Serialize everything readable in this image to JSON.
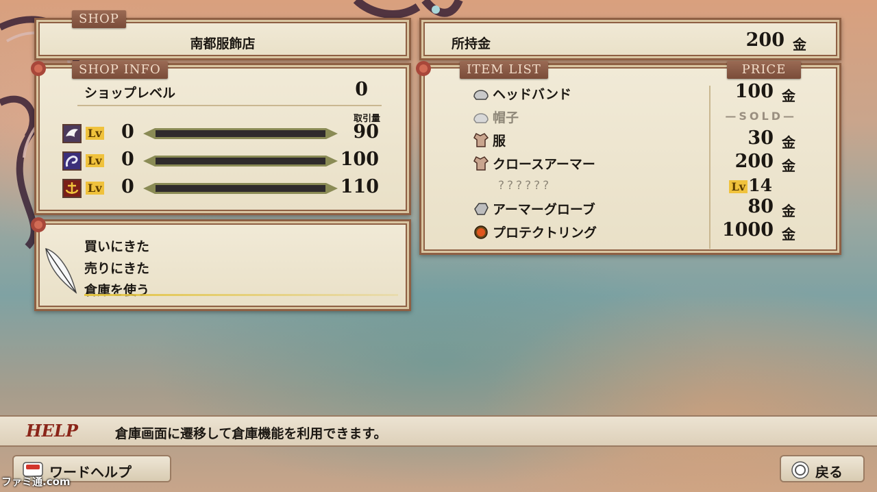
{
  "colors": {
    "tab": "#8a5a46",
    "accent_help": "#8a2519",
    "lv_tag": "#f0c23c"
  },
  "shop": {
    "tab": "SHOP",
    "name": "南都服飾店"
  },
  "money": {
    "label": "所持金",
    "value": "200",
    "unit": "金"
  },
  "shop_info": {
    "tab": "SHOP INFO",
    "level_label": "ショップレベル",
    "level_value": "0",
    "volume_label": "取引量",
    "lv_tag": "Lv",
    "guilds": [
      {
        "icon": "dove-icon",
        "lv": "0",
        "volume": "90"
      },
      {
        "icon": "serpent-icon",
        "lv": "0",
        "volume": "100"
      },
      {
        "icon": "anchor-icon",
        "lv": "0",
        "volume": "110"
      }
    ]
  },
  "menu": {
    "items": [
      "買いにきた",
      "売りにきた",
      "倉庫を使う"
    ],
    "selected_index": 2
  },
  "item_list": {
    "tab": "ITEM LIST",
    "price_tab": "PRICE",
    "unit": "金",
    "items": [
      {
        "icon": "helmet-icon",
        "name": "ヘッドバンド",
        "price": "100"
      },
      {
        "icon": "helmet-icon",
        "name": "帽子",
        "sold": "—SOLD—"
      },
      {
        "icon": "clothes-icon",
        "name": "服",
        "price": "30"
      },
      {
        "icon": "clothes-icon",
        "name": "クロースアーマー",
        "price": "200"
      },
      {
        "name": "??????",
        "lv_tag": "Lv",
        "lv": "14"
      },
      {
        "icon": "gauntlet-icon",
        "name": "アーマーグローブ",
        "price": "80"
      },
      {
        "icon": "ring-icon",
        "name": "プロテクトリング",
        "price": "1000"
      }
    ]
  },
  "help": {
    "label": "HELP",
    "text": "倉庫画面に遷移して倉庫機能を利用できます。"
  },
  "buttons": {
    "word_help": "ワードヘルプ",
    "back": "戻る"
  },
  "watermark": "ファミ通.com"
}
